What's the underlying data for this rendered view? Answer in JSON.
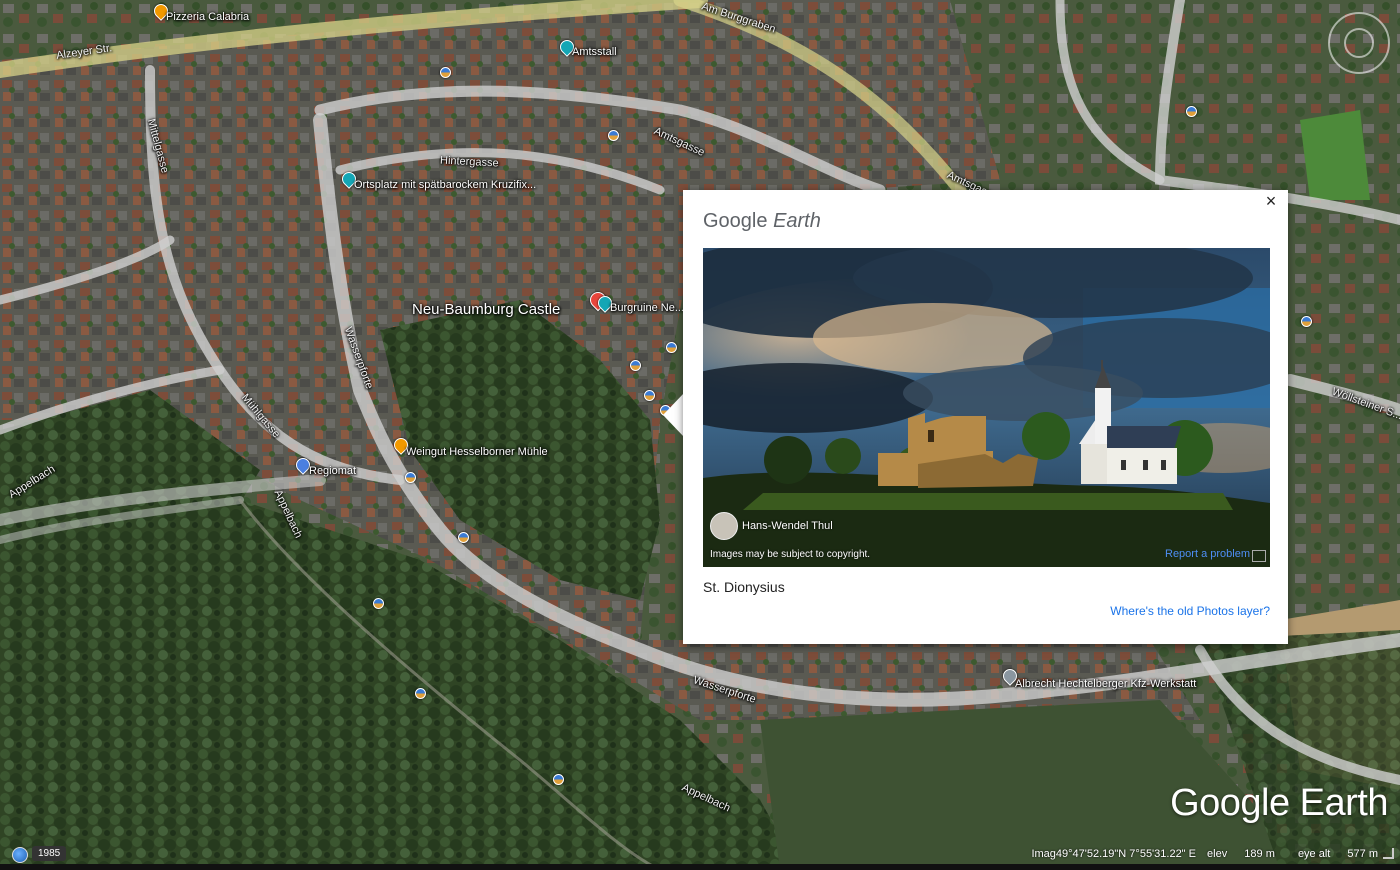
{
  "map": {
    "labels": {
      "pizzeria": "Pizzeria Calabria",
      "alzeyer": "Alzeyer Str.",
      "amtsstall": "Amtsstall",
      "ortsplatz": "Ortsplatz mit spätbarockem Kruzifix...",
      "castle": "Neu-Baumburg Castle",
      "burgruine": "Burgruine Ne...",
      "weingut": "Weingut Hesselborner Mühle",
      "regiomat": "Regiomat",
      "wasserpforte_a": "Wasserpforte",
      "wasserpforte_b": "Wasserpforte",
      "appelbach_a": "Appelbach",
      "appelbach_b": "Appelbach",
      "appelbach_c": "Appelbach",
      "albrecht": "Albrecht Hechtelberger Kfz-Werkstatt",
      "wollsteiner": "Wöllsteiner S...",
      "amtsgasse": "Amtsgasse",
      "amtsgasse_b": "Amtsgasse",
      "mittelgasse": "Mittelgasse",
      "muehlgasse": "Mühlgasse",
      "hintergasse": "Hintergasse",
      "amburgweg": "Am Burggraben"
    }
  },
  "popup": {
    "brand_google": "Google",
    "brand_earth": "Earth",
    "close": "×",
    "credit_name": "Hans-Wendel Thul",
    "copyright": "Images may be subject to copyright.",
    "report": "Report a problem",
    "title": "St. Dionysius",
    "link": "Where's the old Photos layer?"
  },
  "watermark": "Google Earth",
  "status": {
    "year": "1985",
    "imagery": "Imag",
    "coords": "49°47'52.19\"N  7°55'31.22\" E",
    "elev_label": "elev",
    "elev_value": "189 m",
    "eye_label": "eye alt",
    "eye_value": "577 m"
  },
  "colors": {
    "link": "#1a73e8",
    "report": "#4e8ef5",
    "pin_red": "#e8453c",
    "pin_teal": "#14a6b5",
    "pin_orange": "#f29900",
    "pin_blue": "#4a7fe0",
    "pin_gray": "#8a96a0"
  }
}
